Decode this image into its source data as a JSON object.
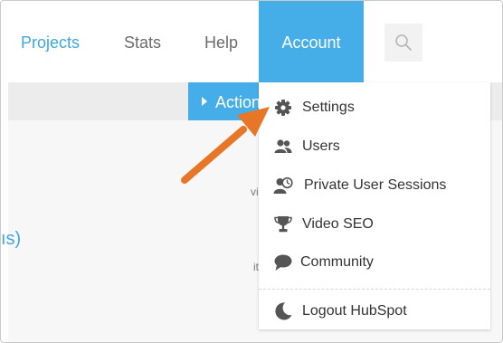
{
  "nav": {
    "items": [
      {
        "label": "Projects"
      },
      {
        "label": "Stats"
      },
      {
        "label": "Help"
      },
      {
        "label": "Account"
      }
    ],
    "search_icon": "search-icon"
  },
  "toolbar": {
    "actions_label": "Actions"
  },
  "background": {
    "left_text": "ıs)",
    "frag1": "vi",
    "frag2": "it"
  },
  "account_menu": {
    "items": [
      {
        "label": "Settings",
        "icon": "gear-icon"
      },
      {
        "label": "Users",
        "icon": "users-icon"
      },
      {
        "label": "Private User Sessions",
        "icon": "user-clock-icon"
      },
      {
        "label": "Video SEO",
        "icon": "trophy-icon"
      },
      {
        "label": "Community",
        "icon": "speech-bubble-icon"
      },
      {
        "label": "Logout HubSpot",
        "icon": "moon-icon"
      }
    ]
  },
  "colors": {
    "accent": "#45aee8",
    "link": "#3fa7e0",
    "annotation_arrow": "#e77727",
    "menu_text": "#333333",
    "icon": "#555555"
  }
}
